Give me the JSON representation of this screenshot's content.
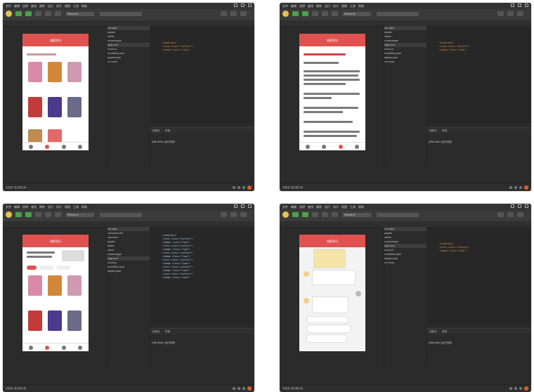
{
  "menu": [
    "文件",
    "编辑",
    "选择",
    "查找",
    "跳转",
    "运行",
    "发行",
    "视图",
    "工具",
    "帮助"
  ],
  "toolbar": {
    "labels": [
      "打开文件",
      "保存",
      "运行",
      "发行",
      "预览"
    ],
    "device_select": "iPhone 6"
  },
  "phone": {
    "title": "电影资讯",
    "chat_title": "电影资讯"
  },
  "tree": {
    "items": [
      "uni-app",
      "pages",
      "static",
      "unpackage",
      "App.vue",
      "main.js",
      "manifest.json",
      "pages.json",
      "uni.scss"
    ],
    "extra_items": [
      "components",
      "common",
      "store"
    ]
  },
  "code": {
    "lines": [
      "<template>",
      "  <view class=\"content\">",
      "    <image class=\"logo\">"
    ]
  },
  "console": {
    "tabs": [
      "控制台",
      "终端"
    ],
    "message": "[HBuilder] 运行完成"
  },
  "status": {
    "text": "未登录  语法提示库"
  },
  "colors": {
    "accent_red": "#e0524f",
    "accent_green": "#4aa24a",
    "code_orange": "#d68a3a"
  }
}
